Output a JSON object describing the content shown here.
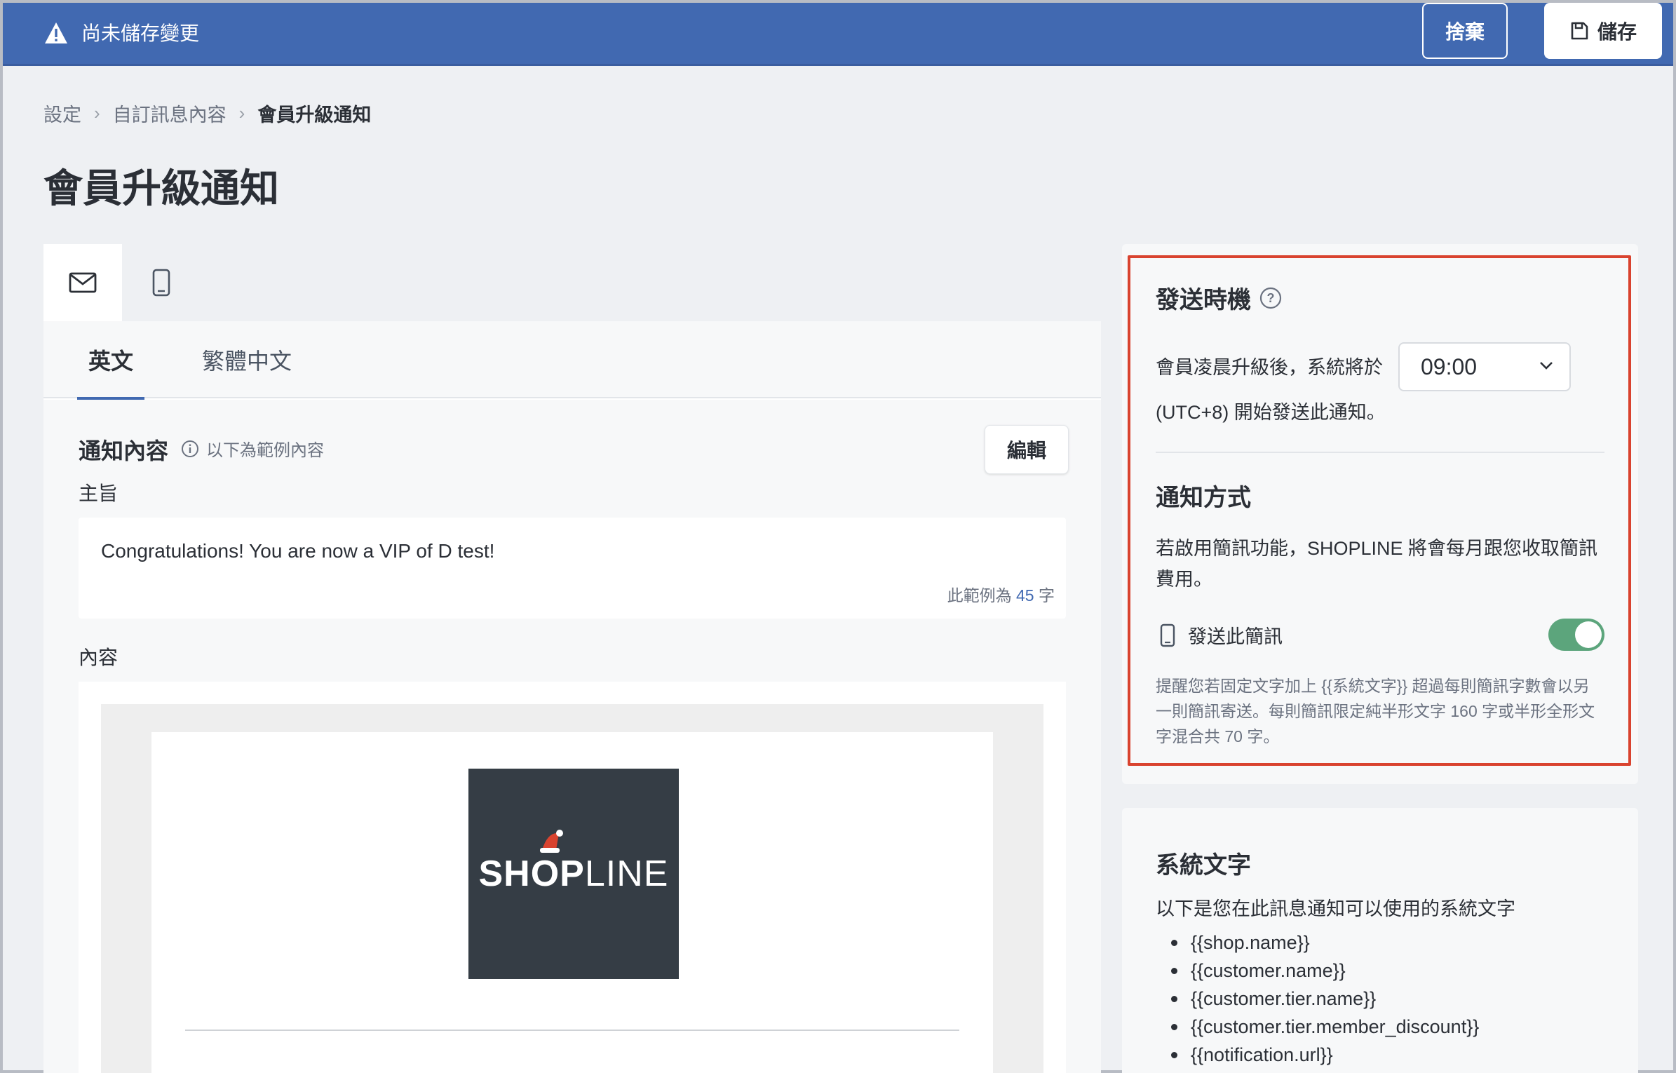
{
  "topbar": {
    "unsaved_message": "尚未儲存變更",
    "discard_label": "捨棄",
    "save_label": "儲存"
  },
  "breadcrumb": {
    "items": [
      "設定",
      "自訂訊息內容"
    ],
    "current": "會員升級通知"
  },
  "page": {
    "title": "會員升級通知"
  },
  "channels": [
    {
      "icon": "mail-icon",
      "active": true
    },
    {
      "icon": "mobile-phone-icon",
      "active": false
    }
  ],
  "languages": [
    {
      "label": "英文",
      "active": true
    },
    {
      "label": "繁體中文",
      "active": false
    }
  ],
  "notification_content": {
    "title": "通知內容",
    "hint": "以下為範例內容",
    "edit_label": "編輯",
    "subject_label": "主旨",
    "subject_value": "Congratulations! You are now a VIP of D test!",
    "char_count_prefix": "此範例為",
    "char_count_value": "45",
    "char_count_suffix": "字",
    "content_label": "內容",
    "logo_text_bold": "SHOP",
    "logo_text_light": "LINE"
  },
  "send_timing": {
    "title": "發送時機",
    "text_before": "會員凌晨升級後，系統將於",
    "time_value": "09:00",
    "text_after": "(UTC+8) 開始發送此通知。"
  },
  "notification_method": {
    "title": "通知方式",
    "description": "若啟用簡訊功能，SHOPLINE 將會每月跟您收取簡訊費用。",
    "sms_label": "發送此簡訊",
    "sms_enabled": true,
    "note": "提醒您若固定文字加上 {{系統文字}} 超過每則簡訊字數會以另一則簡訊寄送。每則簡訊限定純半形文字 160 字或半形全形文字混合共 70 字。"
  },
  "system_text": {
    "title": "系統文字",
    "description": "以下是您在此訊息通知可以使用的系統文字",
    "variables": [
      "{{shop.name}}",
      "{{customer.name}}",
      "{{customer.tier.name}}",
      "{{customer.tier.member_discount}}",
      "{{notification.url}}"
    ]
  },
  "colors": {
    "topbar": "#4169b1",
    "accent": "#4169b1",
    "toggle_on": "#5ca57c",
    "highlight": "#d9432f"
  }
}
